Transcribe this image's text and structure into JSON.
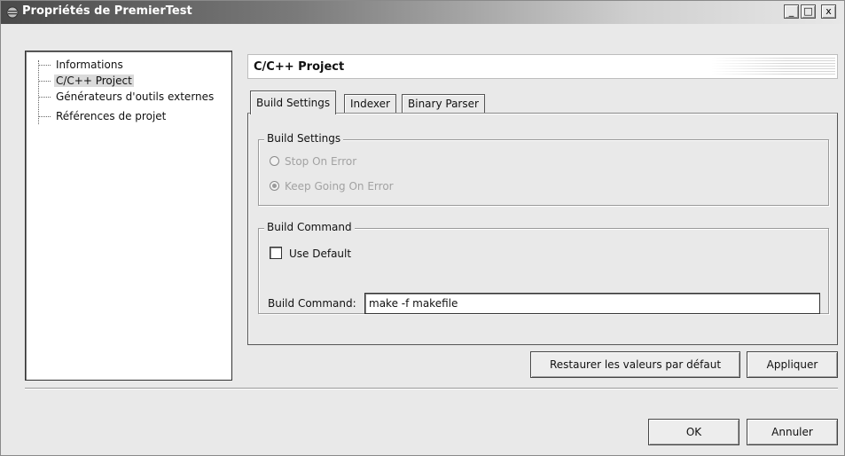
{
  "window": {
    "title": "Propriétés de PremierTest",
    "controls": {
      "minimize": "_",
      "maximize": "□",
      "close": "x"
    }
  },
  "tree": {
    "items": [
      {
        "label": "Informations",
        "selected": false
      },
      {
        "label": "C/C++ Project",
        "selected": true
      },
      {
        "label": "Générateurs d'outils externes",
        "selected": false
      },
      {
        "label": "Références de projet",
        "selected": false
      }
    ]
  },
  "page": {
    "title": "C/C++ Project"
  },
  "tabs": [
    {
      "label": "Build Settings",
      "active": true
    },
    {
      "label": "Indexer",
      "active": false
    },
    {
      "label": "Binary Parser",
      "active": false
    }
  ],
  "build_settings": {
    "group_title": "Build Settings",
    "options": [
      {
        "label": "Stop On Error",
        "checked": false,
        "enabled": false
      },
      {
        "label": "Keep Going On Error",
        "checked": true,
        "enabled": false
      }
    ]
  },
  "build_command": {
    "group_title": "Build Command",
    "use_default_label": "Use Default",
    "use_default_checked": false,
    "field_label": "Build Command:",
    "field_value": "make -f makefile"
  },
  "buttons": {
    "restore_defaults": "Restaurer les valeurs par défaut",
    "apply": "Appliquer",
    "ok": "OK",
    "cancel": "Annuler"
  },
  "icons": {
    "window_icon": "eclipse-window-icon",
    "tree_connector": "dotted-tree-line"
  },
  "colors": {
    "title_bar_start": "#4a4a4a",
    "title_bar_end": "#e8e8e8",
    "dialog_background": "#e9e9e9",
    "selection": "#dadada",
    "disabled_text": "#a2a2a2"
  }
}
